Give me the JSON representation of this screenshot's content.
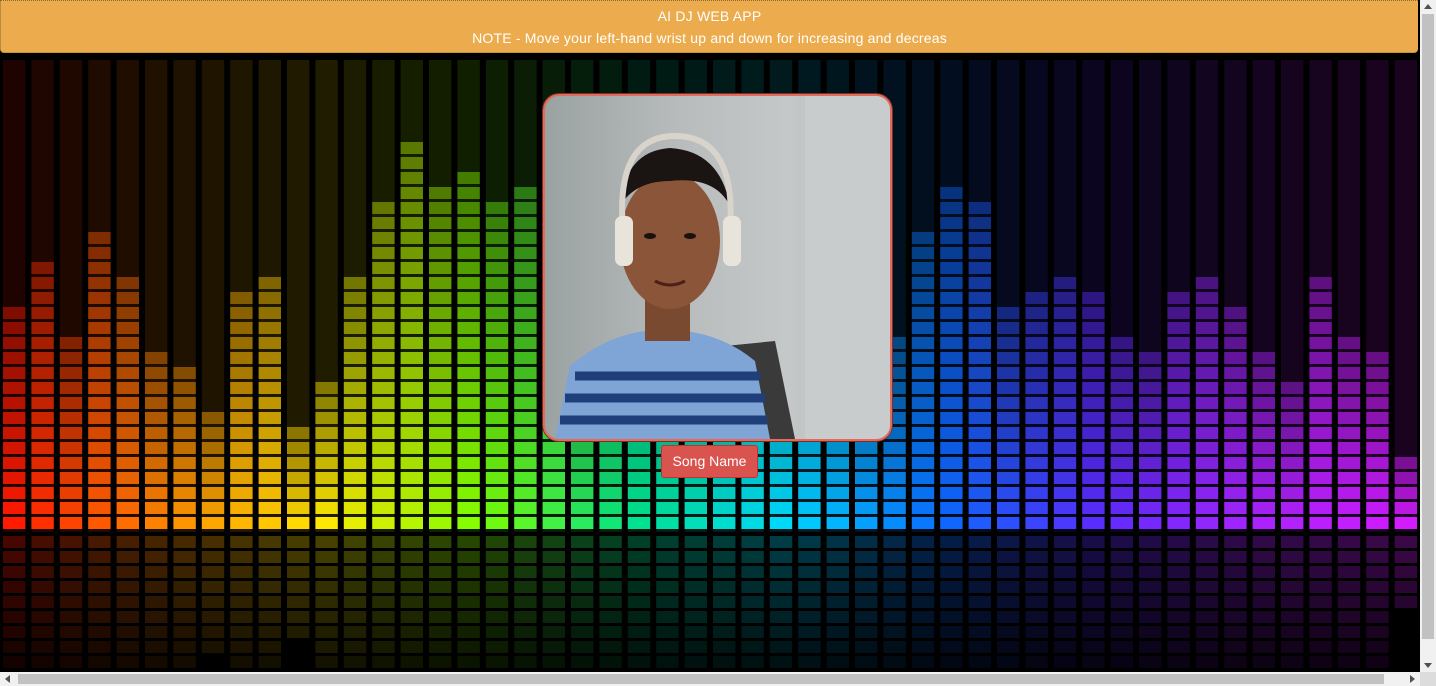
{
  "header": {
    "title": "AI DJ WEB APP",
    "note": "NOTE - Move your left-hand wrist up and down for increasing and decreas"
  },
  "player": {
    "song_button_label": "Song Name"
  },
  "background": {
    "image": "rainbow-equalizer-bars",
    "bar_levels": [
      0.45,
      0.55,
      0.38,
      0.6,
      0.52,
      0.36,
      0.33,
      0.25,
      0.47,
      0.52,
      0.2,
      0.3,
      0.5,
      0.66,
      0.78,
      0.7,
      0.72,
      0.66,
      0.7,
      0.72,
      0.4,
      0.45,
      0.5,
      0.48,
      0.44,
      0.46,
      0.5,
      0.42,
      0.45,
      0.38,
      0.35,
      0.4,
      0.6,
      0.7,
      0.65,
      0.45,
      0.48,
      0.52,
      0.48,
      0.4,
      0.35,
      0.48,
      0.52,
      0.44,
      0.37,
      0.3,
      0.5,
      0.4,
      0.36,
      0.15
    ],
    "colors": [
      "#ff1a00",
      "#ff8a00",
      "#ffe800",
      "#7fff00",
      "#00e28a",
      "#00d8ff",
      "#0a6bff",
      "#5a2cff",
      "#a823ff",
      "#d21bff"
    ]
  },
  "webcam": {
    "label": "webcam-feed",
    "frame_color": "#e36b5b"
  },
  "colors": {
    "header_bg": "#ecac4e",
    "button_bg": "#d9534f"
  }
}
